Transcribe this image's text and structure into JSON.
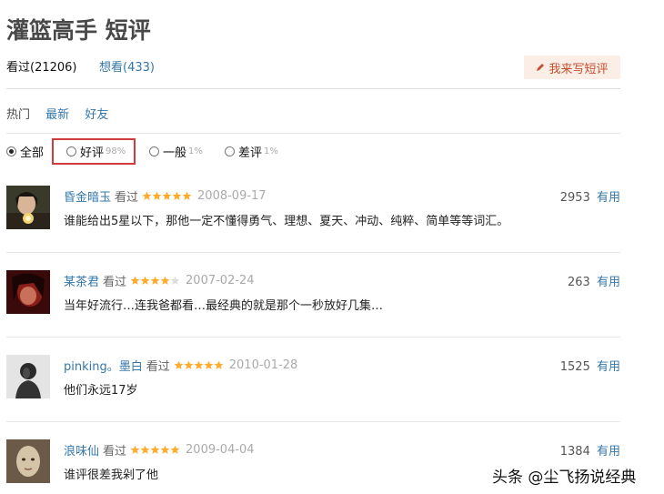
{
  "page": {
    "title": "灌篮高手 短评"
  },
  "tabs": [
    {
      "label": "看过(21206)"
    },
    {
      "label": "想看(433)"
    }
  ],
  "write_button": {
    "label": "我来写短评"
  },
  "sort": [
    {
      "label": "热门"
    },
    {
      "label": "最新"
    },
    {
      "label": "好友"
    }
  ],
  "filters": [
    {
      "label": "全部",
      "pct": "",
      "checked": true
    },
    {
      "label": "好评",
      "pct": "98%",
      "checked": false
    },
    {
      "label": "一般",
      "pct": "1%",
      "checked": false
    },
    {
      "label": "差评",
      "pct": "1%",
      "checked": false
    }
  ],
  "reviews": [
    {
      "user": "昏金暗玉",
      "status": "看过",
      "rating": 5,
      "date": "2008-09-17",
      "votes": "2953",
      "useful": "有用",
      "comment": "谁能给出5星以下，那他一定不懂得勇气、理想、夏天、冲动、纯粹、简单等等词汇。"
    },
    {
      "user": "某茶君",
      "status": "看过",
      "rating": 4,
      "date": "2007-02-24",
      "votes": "263",
      "useful": "有用",
      "comment": "当年好流行…连我爸都看…最经典的就是那个一秒放好几集…"
    },
    {
      "user": "pinking。墨白",
      "status": "看过",
      "rating": 5,
      "date": "2010-01-28",
      "votes": "1525",
      "useful": "有用",
      "comment": "他们永远17岁"
    },
    {
      "user": "浪味仙",
      "status": "看过",
      "rating": 5,
      "date": "2009-04-04",
      "votes": "1384",
      "useful": "有用",
      "comment": "谁评很差我剁了他"
    }
  ],
  "watermark": "头条 @尘飞扬说经典",
  "colors": {
    "link": "#3377aa",
    "star": "#ffac2d",
    "highlight": "#d23b3b",
    "button_bg": "#fbeee6",
    "button_text": "#c64f2f"
  }
}
